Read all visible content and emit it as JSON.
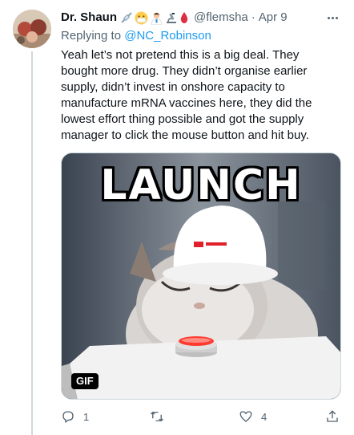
{
  "tweet": {
    "author_name": "Dr. Shaun",
    "author_emojis": [
      "syringe-icon",
      "mask-face-icon",
      "scientist-icon",
      "microscope-icon",
      "blood-drop-icon"
    ],
    "handle": "@flemsha",
    "separator": "·",
    "date": "Apr 9",
    "replying_prefix": "Replying to ",
    "replying_to": "@NC_Robinson",
    "text": "Yeah let’s not pretend this is a big deal. They bought more drug. They didn’t organise earlier supply, didn’t invest in onshore capacity to manufacture mRNA vaccines here, they did the lowest effort thing possible and got the supply manager to click the mouse button and hit buy.",
    "media": {
      "caption_text": "LAUNCH",
      "badge": "GIF"
    },
    "actions": {
      "reply_count": "1",
      "retweet_count": "",
      "like_count": "4"
    }
  },
  "colors": {
    "accent": "#1d9bf0",
    "secondary_text": "#536471",
    "primary_text": "#0f1419",
    "thread_line": "#cfd9de"
  }
}
